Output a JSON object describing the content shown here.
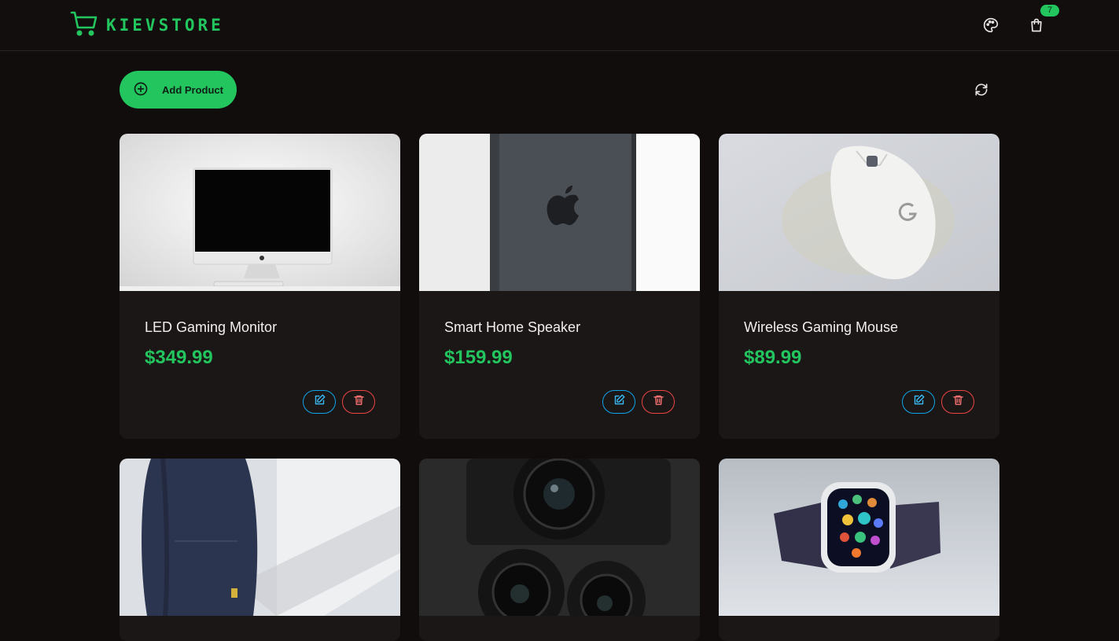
{
  "brand": {
    "name": "KIEVSTORE",
    "icon": "shopping-cart-icon",
    "color": "#22c55e"
  },
  "nav": {
    "theme_icon": "palette-icon",
    "cart_icon": "shopping-bag-icon",
    "cart_count": "7"
  },
  "toolbar": {
    "add_label": "Add Product",
    "add_icon": "plus-circle-icon",
    "refresh_icon": "refresh-icon"
  },
  "products": [
    {
      "title": "LED Gaming Monitor",
      "price": "$349.99",
      "image": "monitor-photo"
    },
    {
      "title": "Smart Home Speaker",
      "price": "$159.99",
      "image": "phone-photo"
    },
    {
      "title": "Wireless Gaming Mouse",
      "price": "$89.99",
      "image": "mouse-photo"
    },
    {
      "title": "",
      "price": "",
      "image": "backpack-photo"
    },
    {
      "title": "",
      "price": "",
      "image": "camera-photo"
    },
    {
      "title": "",
      "price": "",
      "image": "smartwatch-photo"
    }
  ],
  "colors": {
    "accent": "#22c55e",
    "edit": "#0ea5e9",
    "delete": "#ef4444",
    "background": "#120d0d",
    "card": "#1c1717"
  }
}
